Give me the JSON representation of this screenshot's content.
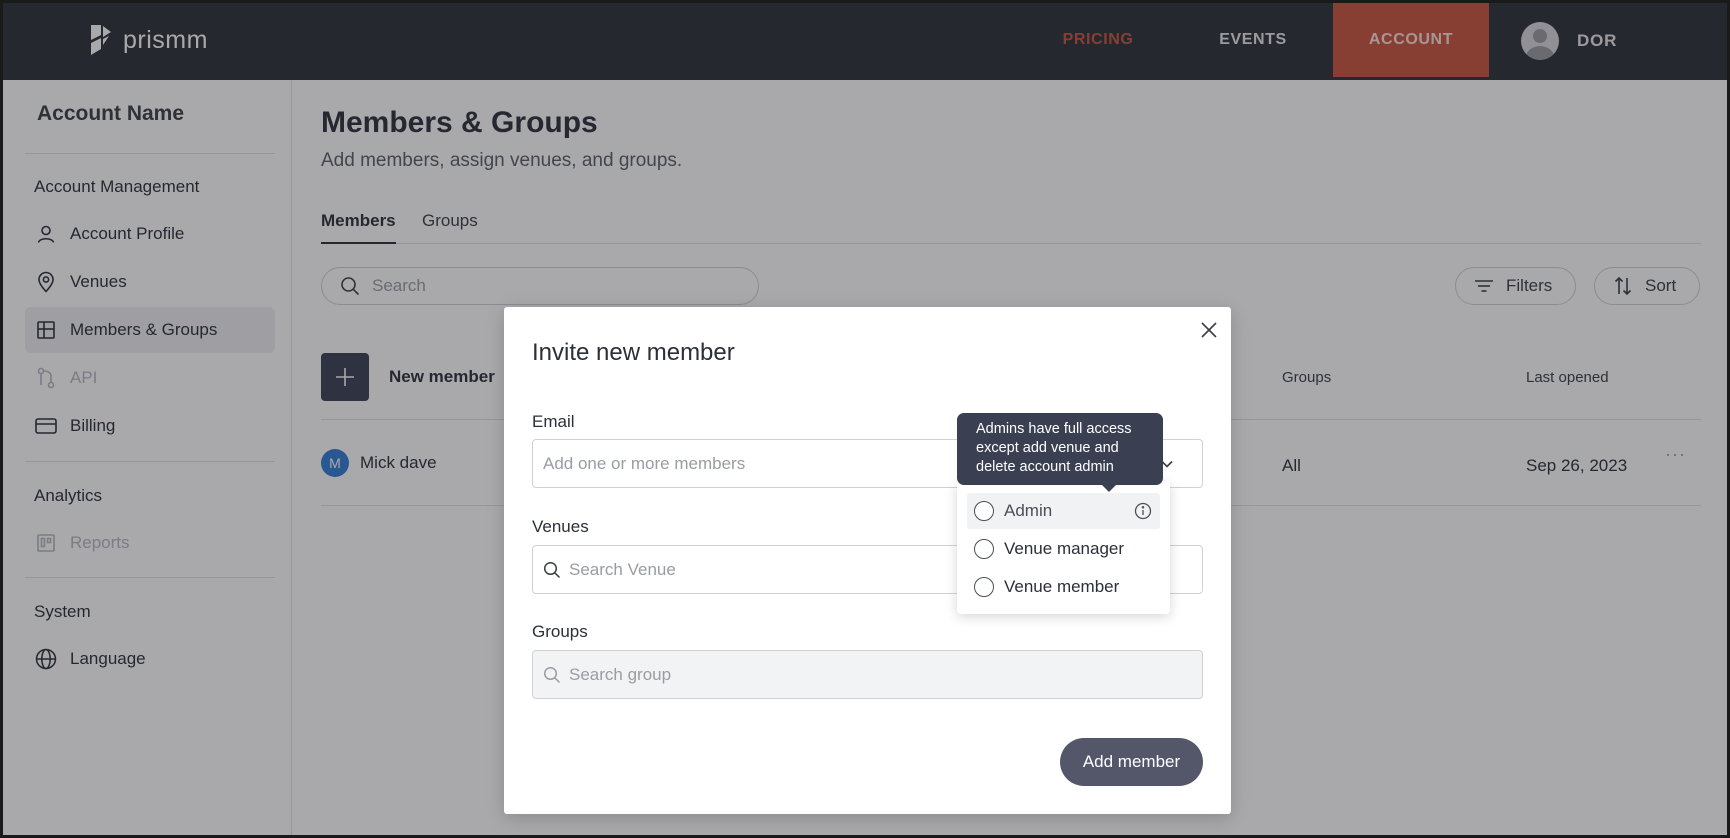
{
  "topbar": {
    "brand": "prismm",
    "nav": {
      "pricing": "PRICING",
      "events": "EVENTS",
      "account": "ACCOUNT"
    },
    "user_name": "DOR",
    "colors": {
      "bar": "#2c3038",
      "accent": "#c8553d"
    }
  },
  "sidebar": {
    "account_name": "Account Name",
    "sections": {
      "management": "Account Management",
      "analytics": "Analytics",
      "system": "System"
    },
    "items": {
      "profile": {
        "label": "Account Profile",
        "icon": "user-icon"
      },
      "venues": {
        "label": "Venues",
        "icon": "location-pin-icon"
      },
      "members": {
        "label": "Members & Groups",
        "icon": "grid-icon",
        "active": true
      },
      "api": {
        "label": "API",
        "icon": "api-icon",
        "disabled": true
      },
      "billing": {
        "label": "Billing",
        "icon": "credit-card-icon"
      },
      "reports": {
        "label": "Reports",
        "icon": "reports-icon",
        "disabled": true
      },
      "language": {
        "label": "Language",
        "icon": "globe-icon"
      }
    }
  },
  "main": {
    "title": "Members & Groups",
    "subtitle": "Add members, assign venues, and groups.",
    "tabs": {
      "members": "Members",
      "groups": "Groups"
    },
    "search_placeholder": "Search",
    "filters_label": "Filters",
    "sort_label": "Sort",
    "new_member_label": "New member",
    "columns": {
      "groups": "Groups",
      "last_opened": "Last opened"
    },
    "rows": [
      {
        "initial": "M",
        "name": "Mick dave",
        "groups": "All",
        "last_opened": "Sep 26, 2023",
        "more": "···"
      }
    ]
  },
  "modal": {
    "title": "Invite new member",
    "email_label": "Email",
    "email_placeholder": "Add one or more members",
    "venues_label": "Venues",
    "venues_placeholder": "Search Venue",
    "groups_label": "Groups",
    "groups_placeholder": "Search group",
    "submit_label": "Add member"
  },
  "role_dropdown": {
    "tooltip": "Admins have full access except add venue and delete account admin",
    "options": [
      {
        "label": "Admin",
        "hovered": true
      },
      {
        "label": "Venue manager"
      },
      {
        "label": "Venue member"
      }
    ]
  }
}
